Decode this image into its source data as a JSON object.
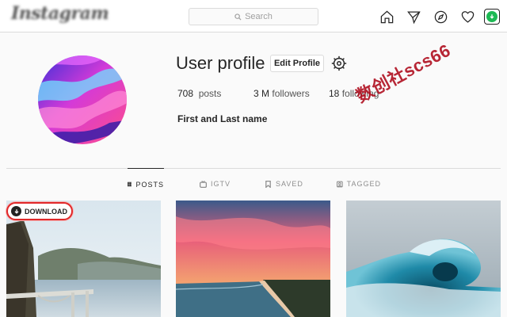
{
  "topbar": {
    "logo_text": "Instagram",
    "search_placeholder": "Search",
    "nav_icons": [
      "home-icon",
      "direct-message-icon",
      "explore-compass-icon",
      "heart-icon",
      "download-extension-icon"
    ]
  },
  "profile": {
    "username": "User profile",
    "edit_label": "Edit Profile",
    "posts_count": "708",
    "posts_label": "posts",
    "followers_count": "3 M",
    "followers_label": "followers",
    "following_count": "18",
    "following_label": "following",
    "full_name": "First and Last name"
  },
  "watermark": "数创社scs66",
  "tabs": [
    {
      "label": "POSTS",
      "icon": "grid-icon",
      "active": true
    },
    {
      "label": "IGTV",
      "icon": "igtv-icon",
      "active": false
    },
    {
      "label": "SAVED",
      "icon": "bookmark-icon",
      "active": false
    },
    {
      "label": "TAGGED",
      "icon": "tag-icon",
      "active": false
    }
  ],
  "download_button": {
    "label": "DOWNLOAD"
  },
  "colors": {
    "accent_red": "#e0282a",
    "ext_green": "#1db954",
    "border": "#dbdbdb"
  }
}
